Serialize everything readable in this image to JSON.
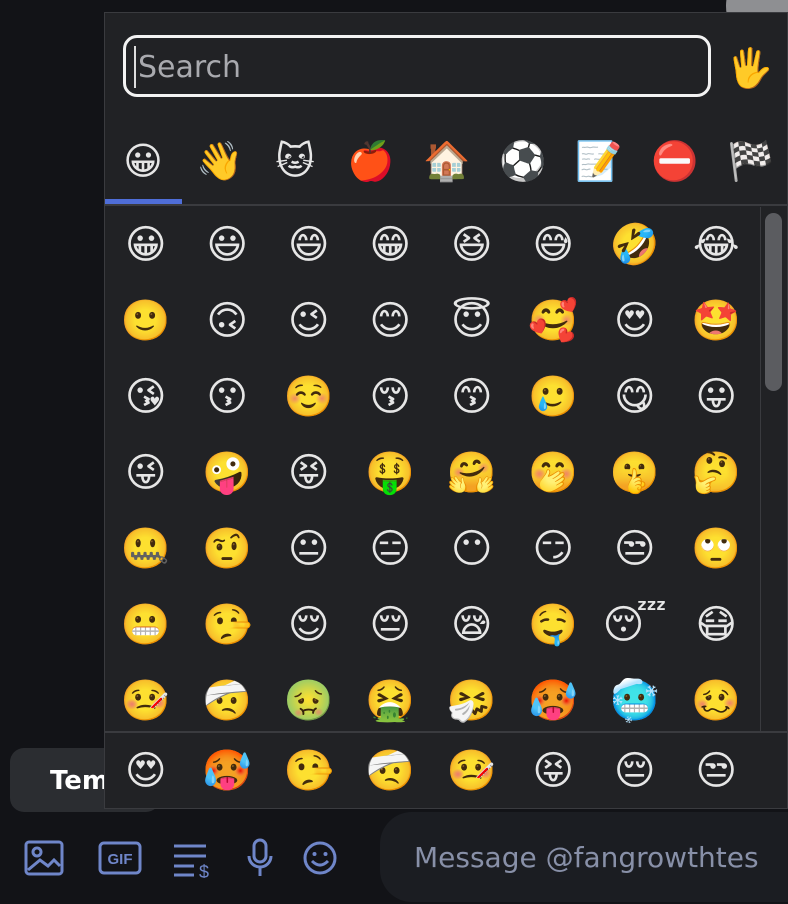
{
  "search": {
    "placeholder": "Search"
  },
  "skin_tone": {
    "emoji": "🖐️"
  },
  "tabs": [
    {
      "name": "smileys",
      "emoji": "😀"
    },
    {
      "name": "people",
      "emoji": "👋"
    },
    {
      "name": "animals",
      "emoji": "🐱"
    },
    {
      "name": "food",
      "emoji": "🍎"
    },
    {
      "name": "travel",
      "emoji": "🏠"
    },
    {
      "name": "activities",
      "emoji": "⚽"
    },
    {
      "name": "objects",
      "emoji": "📝"
    },
    {
      "name": "symbols",
      "emoji": "⛔"
    },
    {
      "name": "flags",
      "emoji": "🏁"
    }
  ],
  "grid": [
    "😀",
    "😃",
    "😄",
    "😁",
    "😆",
    "😅",
    "🤣",
    "😂",
    "🙂",
    "🙃",
    "😉",
    "😊",
    "😇",
    "🥰",
    "😍",
    "🤩",
    "😘",
    "😗",
    "☺️",
    "😚",
    "😙",
    "🥲",
    "😋",
    "😛",
    "😜",
    "🤪",
    "😝",
    "🤑",
    "🤗",
    "🤭",
    "🤫",
    "🤔",
    "🤐",
    "🤨",
    "😐",
    "😑",
    "😶",
    "😏",
    "😒",
    "🙄",
    "😬",
    "🤥",
    "😌",
    "😔",
    "😪",
    "🤤",
    "😴",
    "😷",
    "🤒",
    "🤕",
    "🤢",
    "🤮",
    "🤧",
    "🥵",
    "🥶",
    "🥴"
  ],
  "recent": [
    "😍",
    "🥵",
    "🤥",
    "🤕",
    "🤒",
    "😝",
    "😔",
    "😒"
  ],
  "template_pill": {
    "label": "Tem"
  },
  "composer": {
    "tools": [
      {
        "name": "image-icon",
        "glyph": "🖼"
      },
      {
        "name": "gif-icon",
        "glyph": "GIF"
      },
      {
        "name": "list-dollar-icon",
        "glyph": "≡$"
      },
      {
        "name": "microphone-icon",
        "glyph": "🎤"
      },
      {
        "name": "emoji-icon",
        "glyph": "☺"
      }
    ],
    "message_placeholder": "Message @fangrowthtes"
  }
}
